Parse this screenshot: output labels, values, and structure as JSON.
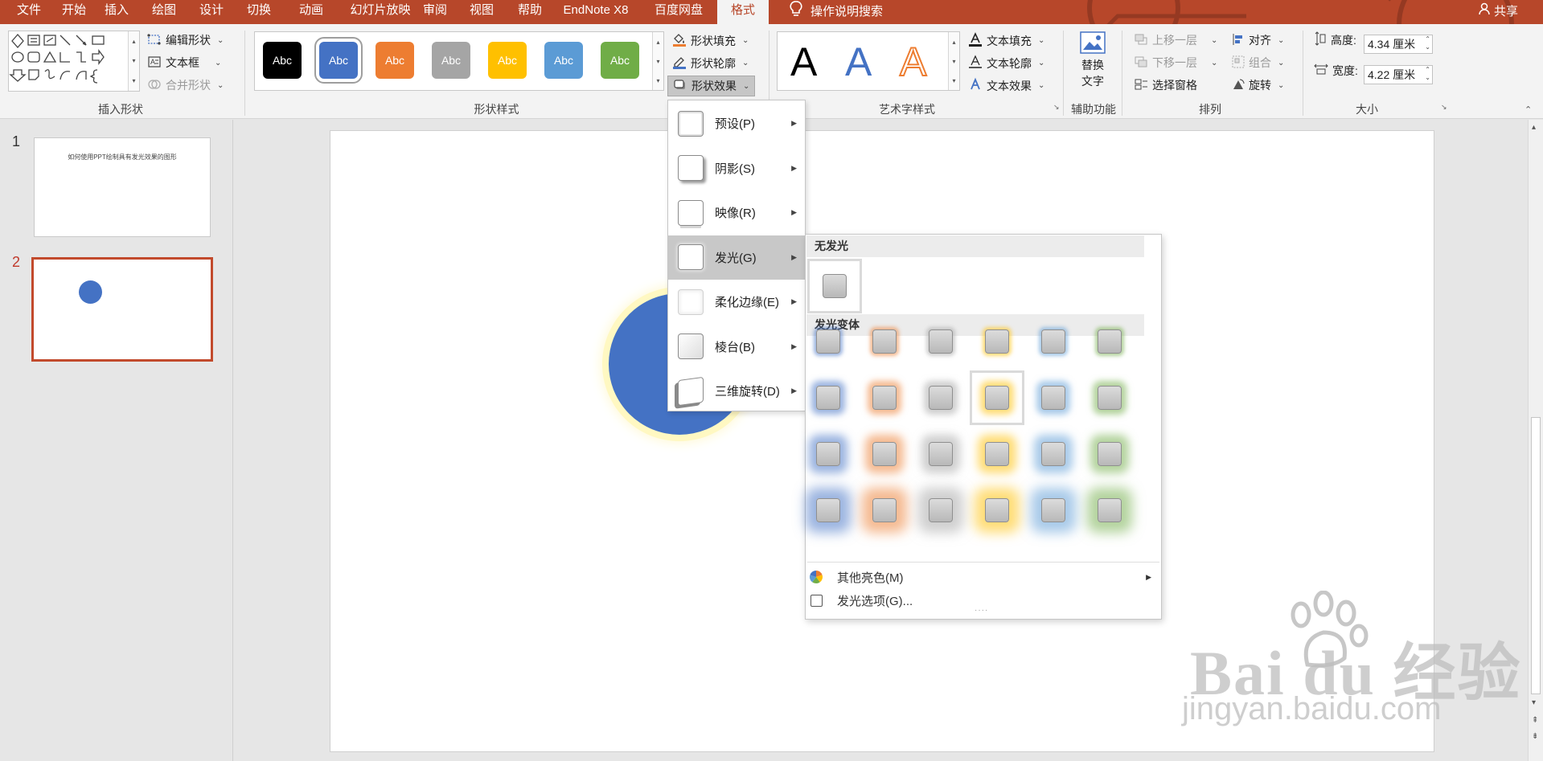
{
  "tabs": [
    {
      "label": "文件",
      "active": false
    },
    {
      "label": "开始",
      "active": false
    },
    {
      "label": "插入",
      "active": false
    },
    {
      "label": "绘图",
      "active": false
    },
    {
      "label": "设计",
      "active": false
    },
    {
      "label": "切换",
      "active": false
    },
    {
      "label": "动画",
      "active": false
    },
    {
      "label": "幻灯片放映",
      "active": false
    },
    {
      "label": "审阅",
      "active": false
    },
    {
      "label": "视图",
      "active": false
    },
    {
      "label": "帮助",
      "active": false
    },
    {
      "label": "EndNote X8",
      "active": false
    },
    {
      "label": "百度网盘",
      "active": false
    },
    {
      "label": "格式",
      "active": true
    }
  ],
  "tell_me": "操作说明搜索",
  "share": "共享",
  "ribbon": {
    "insert_shapes": {
      "label": "插入形状",
      "edit_shape": "编辑形状",
      "text_box": "文本框",
      "merge_shapes": "合并形状"
    },
    "shape_styles": {
      "label": "形状样式",
      "swatch_text": "Abc",
      "swatches": [
        {
          "color": "#000000"
        },
        {
          "color": "#4472c4"
        },
        {
          "color": "#ed7d31"
        },
        {
          "color": "#a5a5a5"
        },
        {
          "color": "#ffc000"
        },
        {
          "color": "#5b9bd5"
        },
        {
          "color": "#70ad47"
        }
      ],
      "fill": "形状填充",
      "outline": "形状轮廓",
      "effects": "形状效果"
    },
    "wordart": {
      "label": "艺术字样式",
      "letters": [
        "A",
        "A",
        "A"
      ],
      "text_fill": "文本填充",
      "text_outline": "文本轮廓",
      "text_effects": "文本效果"
    },
    "accessibility": {
      "label": "辅助功能",
      "alt_text_line1": "替换",
      "alt_text_line2": "文字"
    },
    "arrange": {
      "label": "排列",
      "bring_forward": "上移一层",
      "send_backward": "下移一层",
      "selection_pane": "选择窗格",
      "align": "对齐",
      "group": "组合",
      "rotate": "旋转"
    },
    "size": {
      "label": "大小",
      "height_label": "高度:",
      "height_value": "4.34 厘米",
      "width_label": "宽度:",
      "width_value": "4.22 厘米"
    }
  },
  "slides": [
    {
      "number": "1",
      "title": "如何使用PPT绘制具有发光效果的图形"
    },
    {
      "number": "2"
    }
  ],
  "effects_menu": [
    {
      "label": "预设(P)"
    },
    {
      "label": "阴影(S)"
    },
    {
      "label": "映像(R)"
    },
    {
      "label": "发光(G)",
      "highlighted": true
    },
    {
      "label": "柔化边缘(E)"
    },
    {
      "label": "棱台(B)"
    },
    {
      "label": "三维旋转(D)"
    }
  ],
  "glow_submenu": {
    "no_glow": "无发光",
    "variations": "发光变体",
    "colors": [
      "#4472c4",
      "#ed7d31",
      "#a5a5a5",
      "#ffc000",
      "#5b9bd5",
      "#70ad47"
    ],
    "more_colors": "其他亮色(M)",
    "glow_options": "发光选项(G)..."
  },
  "watermark": {
    "brand": "Bai du 经验",
    "url": "jingyan.baidu.com"
  }
}
